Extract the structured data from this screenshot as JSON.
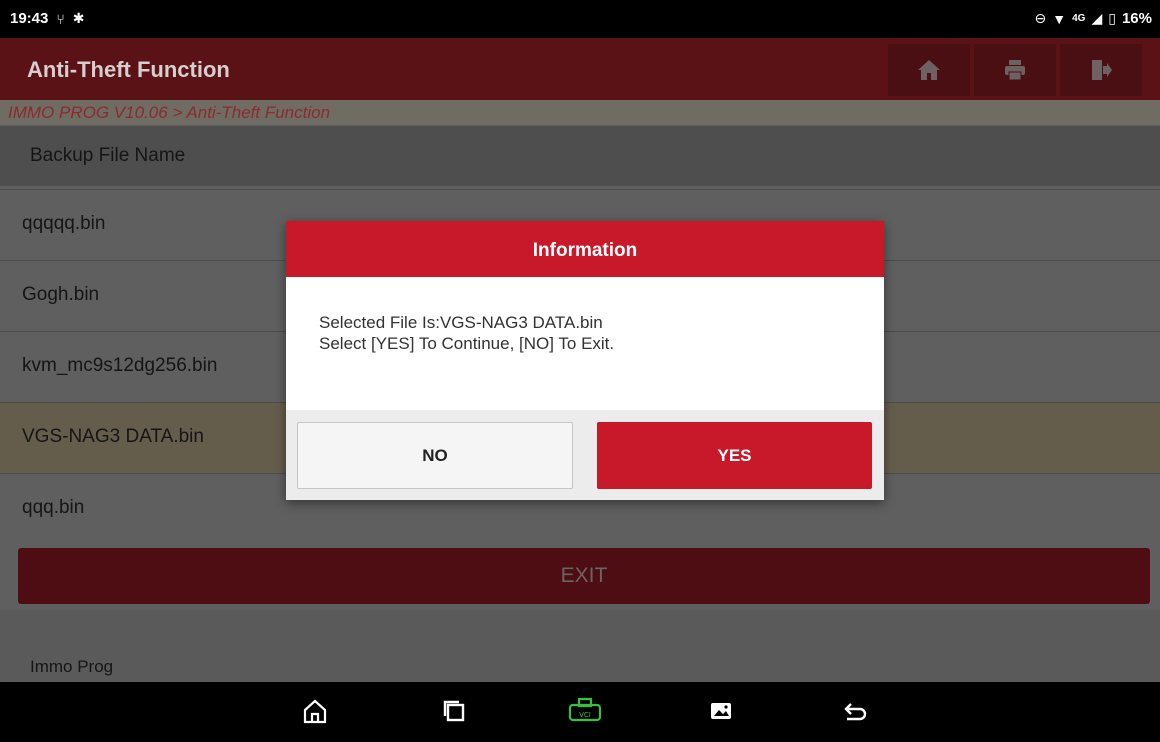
{
  "status_bar": {
    "time": "19:43",
    "left_icons": [
      "usb-icon",
      "bluetooth-icon"
    ],
    "network": "4G",
    "battery": "16%"
  },
  "titlebar": {
    "title": "Anti-Theft Function",
    "buttons": [
      "home-icon",
      "print-icon",
      "exit-icon"
    ]
  },
  "breadcrumb": "IMMO PROG V10.06 > Anti-Theft Function",
  "list": {
    "header": "Backup File Name",
    "items": [
      {
        "name": "qqqqq.bin",
        "selected": false
      },
      {
        "name": "Gogh.bin",
        "selected": false
      },
      {
        "name": "kvm_mc9s12dg256.bin",
        "selected": false
      },
      {
        "name": "VGS-NAG3 DATA.bin",
        "selected": true
      },
      {
        "name": "qqq.bin",
        "selected": false
      }
    ]
  },
  "exit_label": "EXIT",
  "footer_label": "Immo Prog",
  "dialog": {
    "title": "Information",
    "line1": "Selected File Is:VGS-NAG3 DATA.bin",
    "line2": "Select [YES] To Continue, [NO] To Exit.",
    "no_label": "NO",
    "yes_label": "YES"
  },
  "navbar": [
    "home-icon",
    "recent-apps-icon",
    "vci-icon",
    "gallery-icon",
    "back-icon"
  ],
  "colors": {
    "accent": "#c8192a",
    "dimmed_titlebar": "#5a1217",
    "selected_row": "#655d4c",
    "vci_green": "#35c23a"
  }
}
